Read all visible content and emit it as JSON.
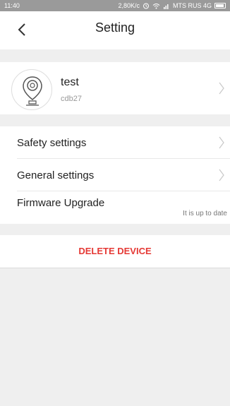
{
  "status_bar": {
    "time": "11:40",
    "speed": "2,80K/c",
    "carrier": "MTS RUS 4G",
    "icons": [
      "alarm-icon",
      "wifi-icon",
      "signal-icon",
      "battery-icon"
    ]
  },
  "header": {
    "title": "Setting",
    "back_icon": "chevron-left-icon"
  },
  "device": {
    "name": "test",
    "id": "cdb27",
    "avatar_icon": "camera-icon"
  },
  "settings": {
    "items": [
      {
        "label": "Safety settings"
      },
      {
        "label": "General settings"
      },
      {
        "label": "Firmware Upgrade",
        "value": "It is up to date"
      }
    ]
  },
  "actions": {
    "delete_label": "DELETE DEVICE"
  },
  "colors": {
    "accent": "#e53935",
    "background": "#efefef",
    "surface": "#ffffff",
    "status_bar": "#9a9a9a"
  }
}
